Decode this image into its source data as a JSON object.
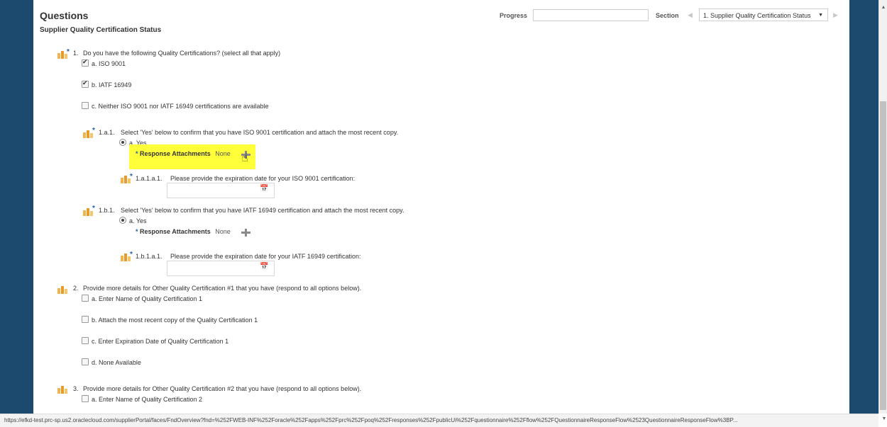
{
  "header": {
    "title": "Questions",
    "subtitle": "Supplier Quality Certification Status",
    "progress_label": "Progress",
    "section_label": "Section",
    "section_value": "1. Supplier Quality Certification Status"
  },
  "q1": {
    "number": "1.",
    "text": "Do you have the following Quality Certifications? (select all that apply)",
    "options": [
      {
        "label": "a. ISO 9001",
        "checked": true
      },
      {
        "label": "b. IATF 16949",
        "checked": true
      },
      {
        "label": "c. Neither ISO 9001 nor IATF 16949 certifications are available",
        "checked": false
      }
    ]
  },
  "q1a1": {
    "number": "1.a.1.",
    "text": "Select 'Yes' below to confirm that you have ISO 9001 certification and attach the most recent copy.",
    "option": "a. Yes",
    "attach_label": "Response Attachments",
    "attach_value": "None"
  },
  "q1a1a1": {
    "number": "1.a.1.a.1.",
    "text": "Please provide the expiration date for your ISO 9001 certification:"
  },
  "q1b1": {
    "number": "1.b.1.",
    "text": "Select 'Yes' below to confirm that you have IATF 16949 certification and attach the most recent copy.",
    "option": "a. Yes",
    "attach_label": "Response Attachments",
    "attach_value": "None"
  },
  "q1b1a1": {
    "number": "1.b.1.a.1.",
    "text": "Please provide the expiration date for your IATF 16949 certification:"
  },
  "q2": {
    "number": "2.",
    "text": "Provide more details for Other Quality Certification #1 that you have (respond to all options below).",
    "options": [
      "a. Enter Name of Quality Certification 1",
      "b. Attach the most recent copy of the Quality Certification 1",
      "c. Enter Expiration Date of Quality Certification 1",
      "d. None Available"
    ]
  },
  "q3": {
    "number": "3.",
    "text": "Provide more details for Other Quality Certification #2 that you have (respond to all options below).",
    "options": [
      "a. Enter Name of Quality Certification 2"
    ]
  },
  "status_url": "https://efkd-test.prc-sp.us2.oraclecloud.com/supplierPortal/faces/FndOverview?fnd=%252FWEB-INF%252Foracle%252Fapps%252Fprc%252Fpoq%252Fresponses%252FpublicUi%252Fquestionnaire%252Fflow%252FQuestionnaireResponseFlow%2523QuestionnaireResponseFlow%3BP..."
}
